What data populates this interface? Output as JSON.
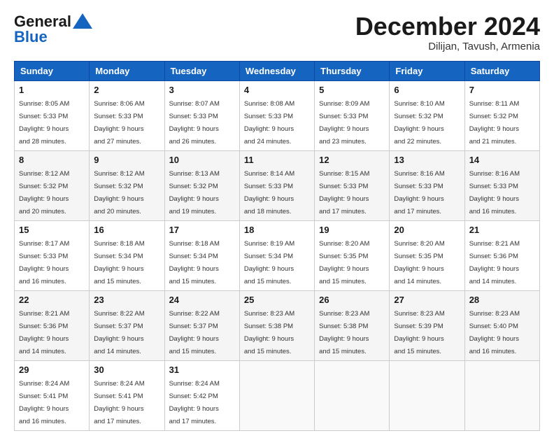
{
  "logo": {
    "line1": "General",
    "line2": "Blue"
  },
  "title": "December 2024",
  "location": "Dilijan, Tavush, Armenia",
  "days_header": [
    "Sunday",
    "Monday",
    "Tuesday",
    "Wednesday",
    "Thursday",
    "Friday",
    "Saturday"
  ],
  "weeks": [
    [
      {
        "num": "1",
        "rise": "8:05 AM",
        "set": "5:33 PM",
        "hours": "9",
        "mins": "28"
      },
      {
        "num": "2",
        "rise": "8:06 AM",
        "set": "5:33 PM",
        "hours": "9",
        "mins": "27"
      },
      {
        "num": "3",
        "rise": "8:07 AM",
        "set": "5:33 PM",
        "hours": "9",
        "mins": "26"
      },
      {
        "num": "4",
        "rise": "8:08 AM",
        "set": "5:33 PM",
        "hours": "9",
        "mins": "24"
      },
      {
        "num": "5",
        "rise": "8:09 AM",
        "set": "5:33 PM",
        "hours": "9",
        "mins": "23"
      },
      {
        "num": "6",
        "rise": "8:10 AM",
        "set": "5:32 PM",
        "hours": "9",
        "mins": "22"
      },
      {
        "num": "7",
        "rise": "8:11 AM",
        "set": "5:32 PM",
        "hours": "9",
        "mins": "21"
      }
    ],
    [
      {
        "num": "8",
        "rise": "8:12 AM",
        "set": "5:32 PM",
        "hours": "9",
        "mins": "20"
      },
      {
        "num": "9",
        "rise": "8:12 AM",
        "set": "5:32 PM",
        "hours": "9",
        "mins": "20"
      },
      {
        "num": "10",
        "rise": "8:13 AM",
        "set": "5:32 PM",
        "hours": "9",
        "mins": "19"
      },
      {
        "num": "11",
        "rise": "8:14 AM",
        "set": "5:33 PM",
        "hours": "9",
        "mins": "18"
      },
      {
        "num": "12",
        "rise": "8:15 AM",
        "set": "5:33 PM",
        "hours": "9",
        "mins": "17"
      },
      {
        "num": "13",
        "rise": "8:16 AM",
        "set": "5:33 PM",
        "hours": "9",
        "mins": "17"
      },
      {
        "num": "14",
        "rise": "8:16 AM",
        "set": "5:33 PM",
        "hours": "9",
        "mins": "16"
      }
    ],
    [
      {
        "num": "15",
        "rise": "8:17 AM",
        "set": "5:33 PM",
        "hours": "9",
        "mins": "16"
      },
      {
        "num": "16",
        "rise": "8:18 AM",
        "set": "5:34 PM",
        "hours": "9",
        "mins": "15"
      },
      {
        "num": "17",
        "rise": "8:18 AM",
        "set": "5:34 PM",
        "hours": "9",
        "mins": "15"
      },
      {
        "num": "18",
        "rise": "8:19 AM",
        "set": "5:34 PM",
        "hours": "9",
        "mins": "15"
      },
      {
        "num": "19",
        "rise": "8:20 AM",
        "set": "5:35 PM",
        "hours": "9",
        "mins": "15"
      },
      {
        "num": "20",
        "rise": "8:20 AM",
        "set": "5:35 PM",
        "hours": "9",
        "mins": "14"
      },
      {
        "num": "21",
        "rise": "8:21 AM",
        "set": "5:36 PM",
        "hours": "9",
        "mins": "14"
      }
    ],
    [
      {
        "num": "22",
        "rise": "8:21 AM",
        "set": "5:36 PM",
        "hours": "9",
        "mins": "14"
      },
      {
        "num": "23",
        "rise": "8:22 AM",
        "set": "5:37 PM",
        "hours": "9",
        "mins": "14"
      },
      {
        "num": "24",
        "rise": "8:22 AM",
        "set": "5:37 PM",
        "hours": "9",
        "mins": "15"
      },
      {
        "num": "25",
        "rise": "8:23 AM",
        "set": "5:38 PM",
        "hours": "9",
        "mins": "15"
      },
      {
        "num": "26",
        "rise": "8:23 AM",
        "set": "5:38 PM",
        "hours": "9",
        "mins": "15"
      },
      {
        "num": "27",
        "rise": "8:23 AM",
        "set": "5:39 PM",
        "hours": "9",
        "mins": "15"
      },
      {
        "num": "28",
        "rise": "8:23 AM",
        "set": "5:40 PM",
        "hours": "9",
        "mins": "16"
      }
    ],
    [
      {
        "num": "29",
        "rise": "8:24 AM",
        "set": "5:41 PM",
        "hours": "9",
        "mins": "16"
      },
      {
        "num": "30",
        "rise": "8:24 AM",
        "set": "5:41 PM",
        "hours": "9",
        "mins": "17"
      },
      {
        "num": "31",
        "rise": "8:24 AM",
        "set": "5:42 PM",
        "hours": "9",
        "mins": "17"
      },
      null,
      null,
      null,
      null
    ]
  ]
}
